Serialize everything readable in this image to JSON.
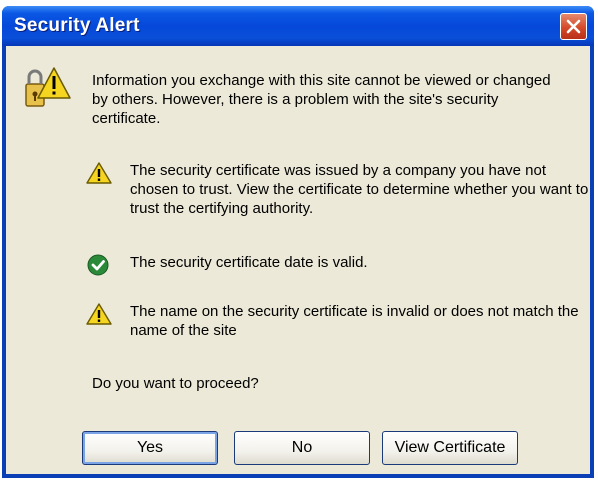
{
  "window": {
    "title": "Security Alert"
  },
  "dialog": {
    "intro": "Information you exchange with this site cannot be viewed or changed by others. However, there is a problem with the site's security certificate.",
    "items": [
      {
        "icon": "warning-icon",
        "text": "The security certificate was issued by a company you have not chosen to trust. View the certificate to determine whether you want to trust the certifying authority."
      },
      {
        "icon": "check-icon",
        "text": "The security certificate date is valid."
      },
      {
        "icon": "warning-icon",
        "text": "The name on the security certificate is invalid or does not match the name of the site"
      }
    ],
    "prompt": "Do you want to proceed?"
  },
  "buttons": {
    "yes": "Yes",
    "no": "No",
    "view_certificate": "View Certificate"
  },
  "colors": {
    "titlebar": "#0548da",
    "close": "#d4492a",
    "client_background": "#ece9d8",
    "warning": "#f5d520",
    "ok": "#2a8a3a"
  }
}
